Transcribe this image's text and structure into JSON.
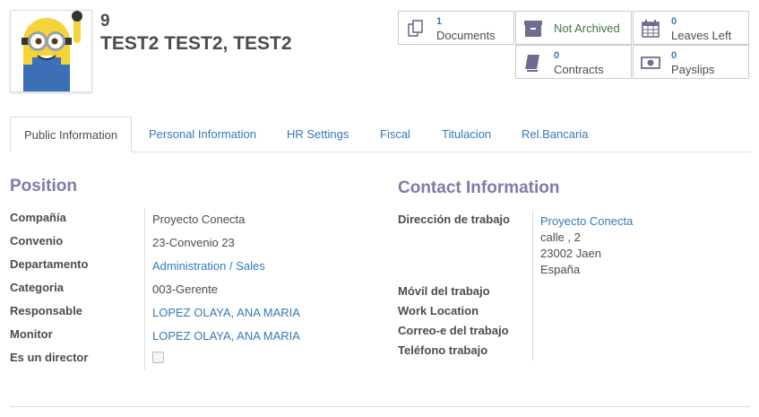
{
  "employee": {
    "id": "9",
    "name": "TEST2 TEST2, TEST2"
  },
  "stats": {
    "documents": {
      "count": "1",
      "label": "Documents",
      "icon": "files-icon"
    },
    "archive": {
      "label": "Not Archived",
      "icon": "archive-icon"
    },
    "leaves": {
      "count": "0",
      "label": "Leaves Left",
      "icon": "calendar-icon"
    },
    "contracts": {
      "count": "0",
      "label": "Contracts",
      "icon": "book-icon"
    },
    "payslips": {
      "count": "0",
      "label": "Payslips",
      "icon": "money-icon"
    }
  },
  "tabs": [
    "Public Information",
    "Personal Information",
    "HR Settings",
    "Fiscal",
    "Titulacion",
    "Rel.Bancaria"
  ],
  "position": {
    "title": "Position",
    "fields": [
      {
        "label": "Compañía",
        "value": "Proyecto Conecta"
      },
      {
        "label": "Convenio",
        "value": "23-Convenio 23"
      },
      {
        "label": "Departamento",
        "value": "Administration / Sales"
      },
      {
        "label": "Categoria",
        "value": "003-Gerente"
      },
      {
        "label": "Responsable",
        "value": "LOPEZ OLAYA, ANA MARIA"
      },
      {
        "label": "Monitor",
        "value": "LOPEZ OLAYA, ANA MARIA"
      },
      {
        "label": "Es un director",
        "value": ""
      }
    ]
  },
  "contact": {
    "title": "Contact Information",
    "address_label": "Dirección de trabajo",
    "address_company": "Proyecto Conecta",
    "address_street": "calle , 2",
    "address_city": "23002 Jaen",
    "address_country": "España",
    "mobile_label": "Móvil del trabajo",
    "location_label": "Work Location",
    "email_label": "Correo-e del trabajo",
    "phone_label": "Teléfono trabajo"
  },
  "colors": {
    "accent": "#7c7bad",
    "link": "#337ab7",
    "status": "#3c763d"
  }
}
